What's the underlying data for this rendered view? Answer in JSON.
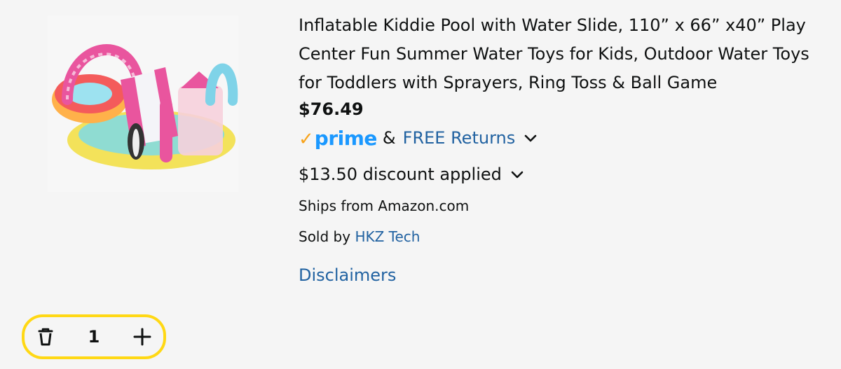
{
  "product": {
    "title": "Inflatable Kiddie Pool with Water Slide, 110” x 66” x40” Play Center Fun Summer Water Toys for Kids, Outdoor Water Toys for Toddlers with Sprayers, Ring Toss & Ball Game",
    "price": "$76.49",
    "image_icon": "inflatable-pool-image"
  },
  "prime": {
    "check": "✓",
    "word": "prime",
    "ampersand": "&",
    "returns_label": "FREE Returns"
  },
  "discount": {
    "text": "$13.50 discount applied"
  },
  "shipping": {
    "ships_from": "Ships from Amazon.com",
    "sold_by_prefix": "Sold by",
    "seller": "HKZ Tech"
  },
  "links": {
    "disclaimers": "Disclaimers"
  },
  "quantity": {
    "value": "1",
    "delete_icon": "trash-icon",
    "add_icon": "plus-icon"
  },
  "colors": {
    "link": "#2162a1",
    "prime_blue": "#1a98ff",
    "prime_check": "#f7a31c",
    "stepper_border": "#ffd814",
    "text": "#0f1111",
    "background": "#f5f5f5"
  }
}
